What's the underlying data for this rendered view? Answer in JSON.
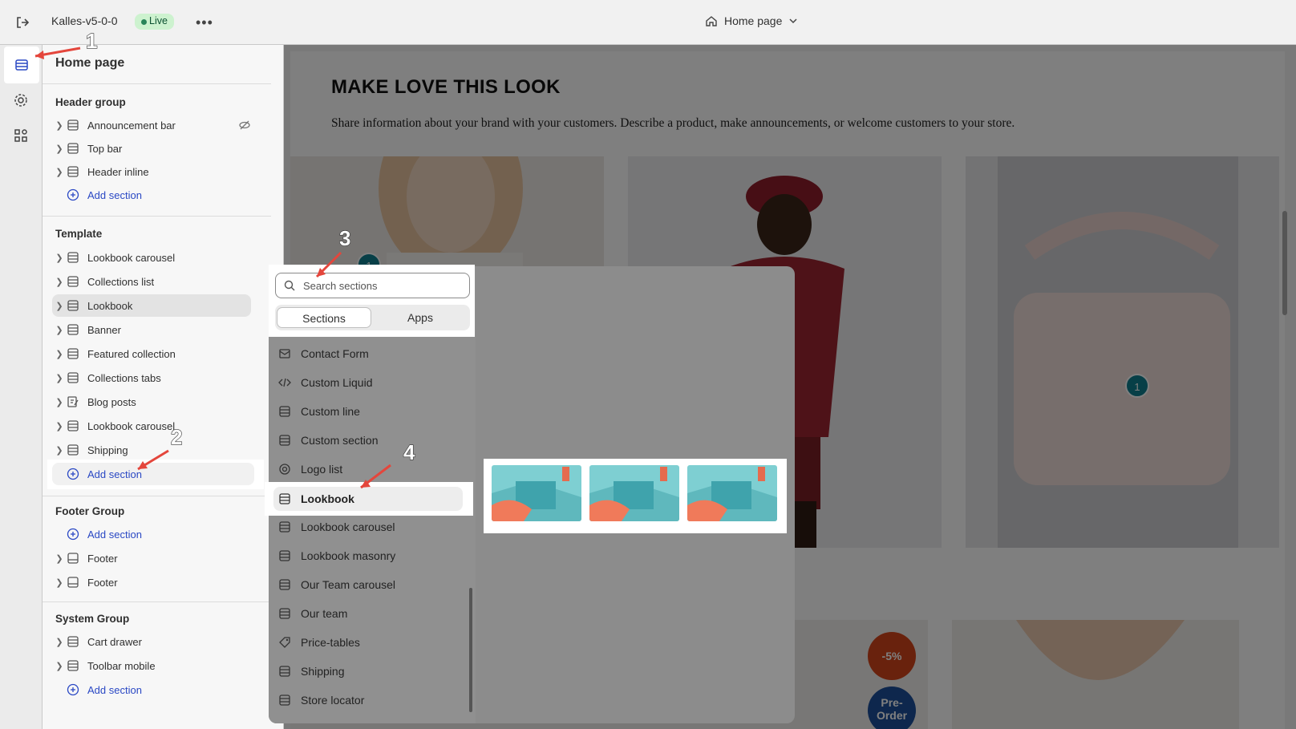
{
  "topbar": {
    "store_name": "Kalles-v5-0-0",
    "status": "Live",
    "page": "Home page"
  },
  "sidebar": {
    "title": "Home page",
    "header_group": {
      "label": "Header group",
      "items": [
        "Announcement bar",
        "Top bar",
        "Header inline"
      ],
      "add": "Add section"
    },
    "template": {
      "label": "Template",
      "items": [
        "Lookbook carousel",
        "Collections list",
        "Lookbook",
        "Banner",
        "Featured collection",
        "Collections tabs",
        "Blog posts",
        "Lookbook carousel",
        "Shipping"
      ],
      "add": "Add section",
      "selected": "Lookbook"
    },
    "footer_group": {
      "label": "Footer Group",
      "add": "Add section",
      "items": [
        "Footer",
        "Footer"
      ]
    },
    "system_group": {
      "label": "System Group",
      "items": [
        "Cart drawer",
        "Toolbar mobile"
      ],
      "add": "Add section"
    }
  },
  "preview": {
    "heading": "MAKE LOVE THIS LOOK",
    "description": "Share information about your brand with your customers. Describe a product, make announcements, or welcome customers to your store.",
    "hotspot_1": "1",
    "hotspot_2": "1",
    "sale_badge": "-5%",
    "preorder_badge": "Pre-\nOrder"
  },
  "picker": {
    "search_placeholder": "Search sections",
    "tabs": [
      "Sections",
      "Apps"
    ],
    "active_tab": "Sections",
    "items": [
      "Contact Form",
      "Custom Liquid",
      "Custom line",
      "Custom section",
      "Logo list",
      "Lookbook",
      "Lookbook carousel",
      "Lookbook masonry",
      "Our Team carousel",
      "Our team",
      "Price-tables",
      "Shipping",
      "Store locator"
    ],
    "highlighted": "Lookbook"
  },
  "annotations": [
    "1",
    "2",
    "3",
    "4"
  ],
  "colors": {
    "accent": "#2a48c4",
    "live_bg": "#cdf2cf",
    "hotspot": "#0e7e8f",
    "sale": "#d2441b",
    "preorder": "#1c4f9a",
    "arrow": "#e4463c"
  }
}
